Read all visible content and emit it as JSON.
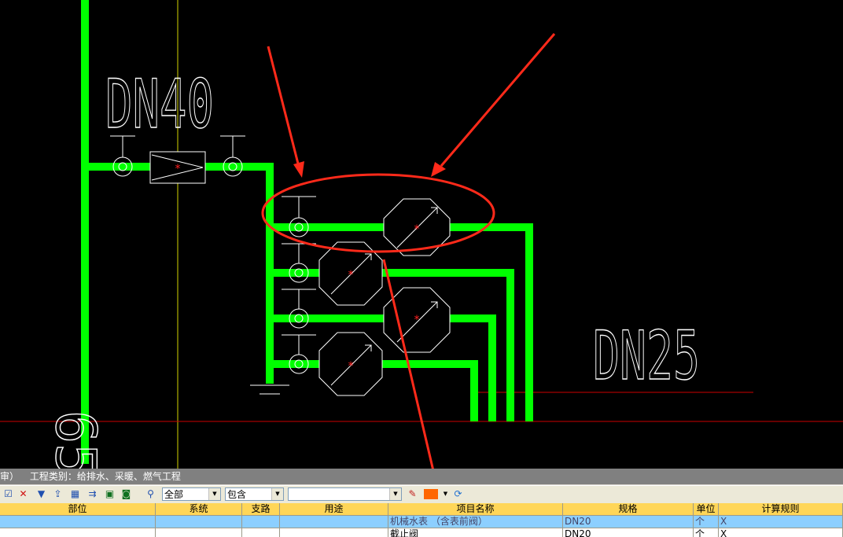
{
  "drawing": {
    "labels": {
      "pipe_main": "DN40",
      "pipe_branch": "DN25",
      "partial_number": "65"
    },
    "colors": {
      "pipe": "#00ff00",
      "reference_line": "#cc0000",
      "grid_line": "#d4d400",
      "annotation": "#ff2a1a",
      "symbol": "#ffffff"
    }
  },
  "info_bar": {
    "segments": [
      "审）",
      "工程类别：给排水、采暖、燃气工程"
    ]
  },
  "toolbar": {
    "icons": [
      "check-delete-icon",
      "delete-icon",
      "filter-icon",
      "import-icon",
      "calculator-icon",
      "export-icon",
      "excel-icon",
      "refresh-sheet-icon",
      "find-icon",
      "highlight-icon",
      "sync-icon"
    ],
    "scope_select": "全部",
    "match_select": "包含",
    "search_value": "",
    "color_swatch": "#ff6600"
  },
  "grid": {
    "columns": [
      "部位",
      "系统",
      "支路",
      "用途",
      "项目名称",
      "规格",
      "单位",
      "计算规则"
    ],
    "rows": [
      [
        "",
        "",
        "",
        "",
        "机械水表 （含表前阀）",
        "DN20",
        "个",
        "X"
      ],
      [
        "",
        "",
        "",
        "",
        "截止阀",
        "DN20",
        "个",
        "X"
      ]
    ]
  }
}
